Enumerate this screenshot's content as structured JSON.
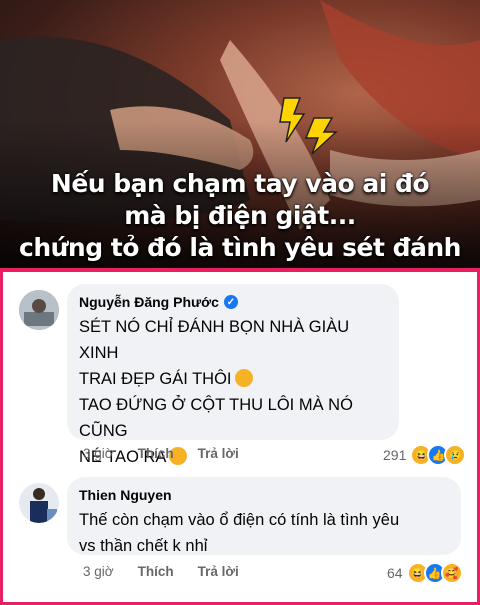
{
  "post_image": {
    "caption_lines": [
      "Nếu bạn chạm tay vào ai đó",
      "mà bị điện giật...",
      "chứng tỏ đó là tình yêu sét đánh"
    ],
    "icon": "lightning-icon"
  },
  "comments": [
    {
      "author": "Nguyễn Đăng Phước",
      "verified": true,
      "lines": [
        "SÉT NÓ CHỈ ĐÁNH BỌN NHÀ GIÀU XINH",
        "TRAI ĐẸP GÁI THÔI",
        "TAO ĐỨNG Ở CỘT THU LÔI MÀ NÓ CŨNG",
        "NÉ TAO RA"
      ],
      "time": "3 giờ",
      "like_label": "Thích",
      "reply_label": "Trả lời",
      "reaction_count": "291",
      "reactions": [
        "haha",
        "like",
        "sad"
      ]
    },
    {
      "author": "Thien Nguyen",
      "verified": false,
      "lines": [
        "Thế còn chạm vào ổ điện có tính là tình yêu",
        "vs thần chết k nhỉ"
      ],
      "time": "3 giờ",
      "like_label": "Thích",
      "reply_label": "Trả lời",
      "reaction_count": "64",
      "reactions": [
        "haha",
        "like",
        "care"
      ]
    }
  ],
  "colors": {
    "frame": "#e91e63",
    "bubble": "#f0f2f5",
    "link": "#1877f2"
  }
}
